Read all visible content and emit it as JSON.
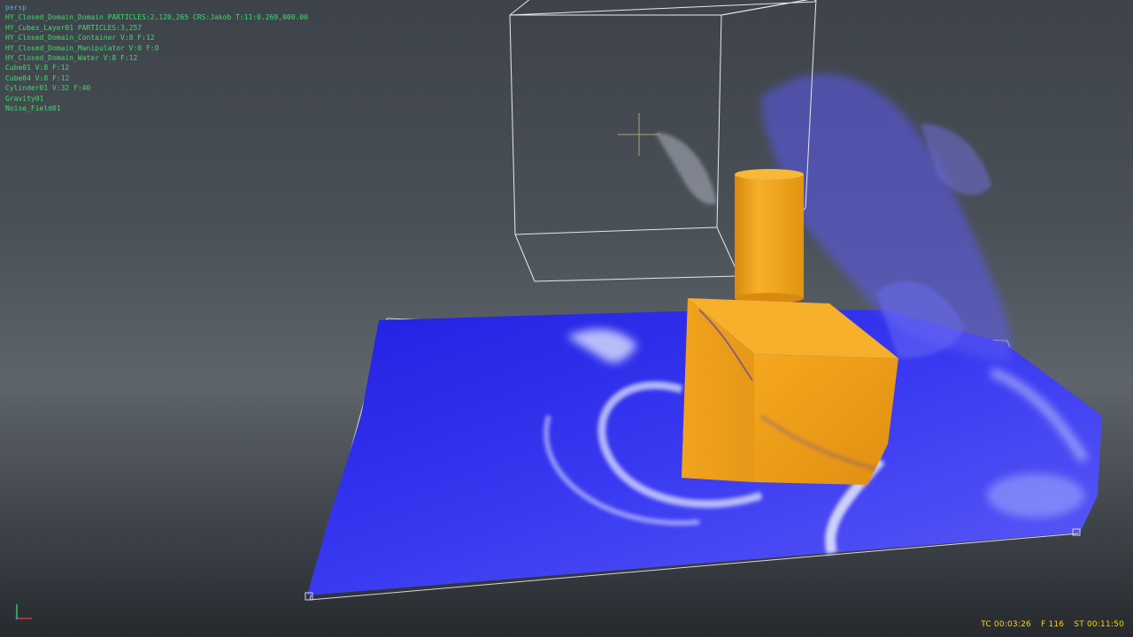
{
  "viewport": {
    "camera_label": "persp",
    "outliner_info": [
      "HY_Closed_Domain_Domain PARTICLES:2,120,265 CRS:Jakob T:11:0.269,000.00",
      "HY_Cubes_Layer01 PARTICLES:3,257",
      "HY_Closed_Domain_Container V:8 F:12",
      "HY_Closed_Domain_Manipulator V:0 F:0",
      "HY_Closed_Domain_Water V:8 F:12",
      "Cube01 V:8 F:12",
      "Cube04 V:8 F:12",
      "Cylinder01 V:32 F:40",
      "Gravity01",
      "Noise_Field01"
    ],
    "timecode": {
      "tc": "TC 00:03:26",
      "frame": "F 116",
      "st": "ST 00:11:50"
    }
  },
  "colors": {
    "hud_camera": "#5aa9e6",
    "hud_objects": "#3ddc6a",
    "hud_timecode": "#ffd400",
    "water": "#4a4af0",
    "foam": "#e6ecff",
    "objects": "#f2a21a",
    "wireframe": "#e8e8e8"
  },
  "icons": [
    "axis-gizmo-icon",
    "crosshair-icon"
  ]
}
